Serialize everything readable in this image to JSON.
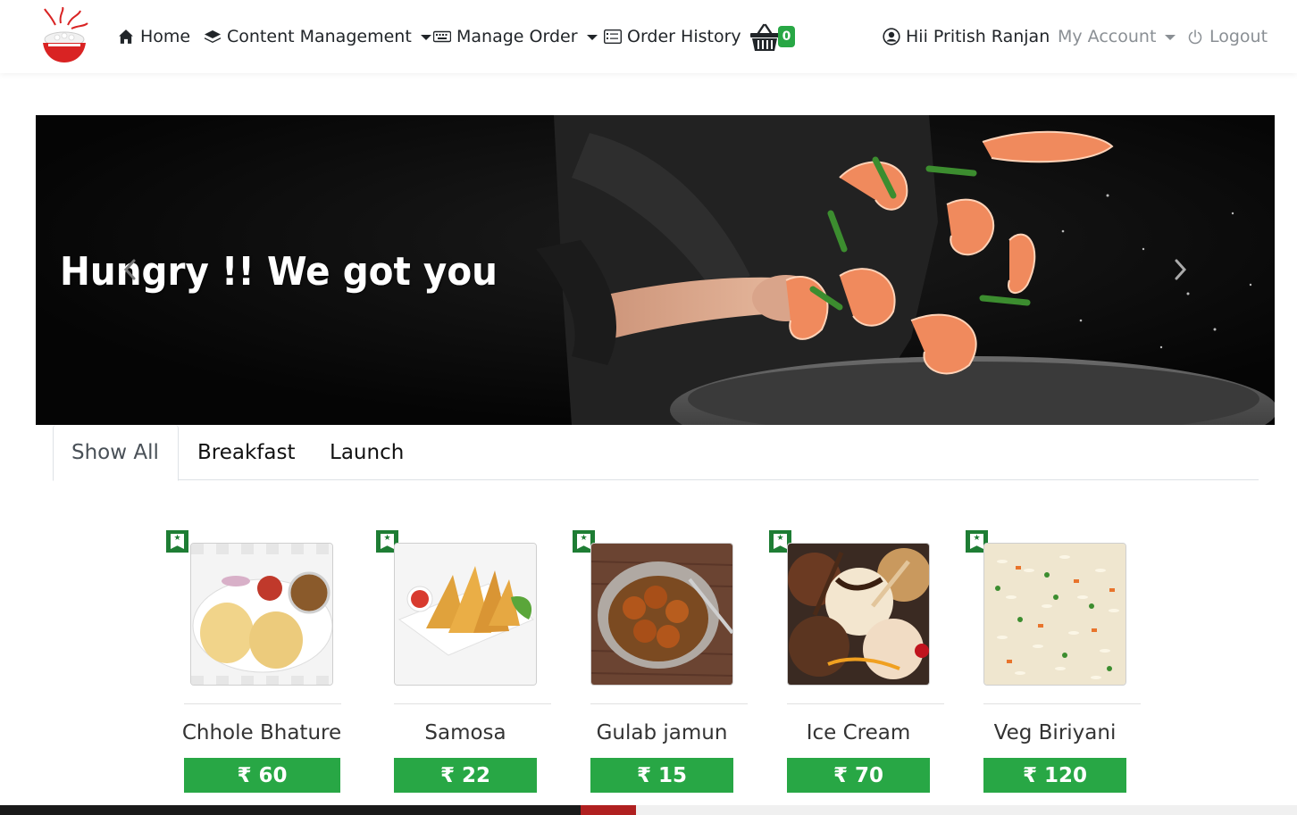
{
  "navbar": {
    "home": "Home",
    "content_management": "Content Management",
    "manage_order": "Manage Order",
    "order_history": "Order History",
    "cart_count": "0",
    "greeting": "Hii Pritish Ranjan",
    "my_account": "My Account",
    "logout": "Logout"
  },
  "carousel": {
    "caption": "Hungry !! We got you"
  },
  "tabs": [
    {
      "label": "Show All",
      "active": true
    },
    {
      "label": "Breakfast",
      "active": false
    },
    {
      "label": "Launch",
      "active": false
    }
  ],
  "products": [
    {
      "name": "Chhole Bhature",
      "price": "₹ 60"
    },
    {
      "name": "Samosa",
      "price": "₹ 22"
    },
    {
      "name": "Gulab jamun",
      "price": "₹ 15"
    },
    {
      "name": "Ice Cream",
      "price": "₹ 70"
    },
    {
      "name": "Veg Biriyani",
      "price": "₹ 120"
    }
  ],
  "colors": {
    "accent_green": "#28a745",
    "bookmark_green": "#1e7d34",
    "logo_red": "#d92323"
  }
}
